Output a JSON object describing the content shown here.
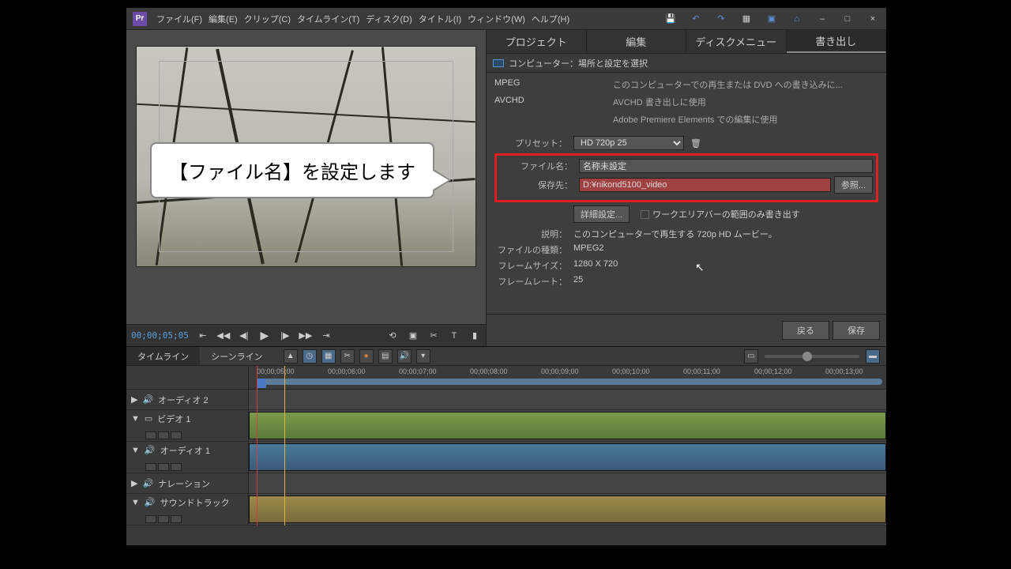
{
  "menubar": {
    "items": [
      "ファイル(F)",
      "編集(E)",
      "クリップ(C)",
      "タイムライン(T)",
      "ディスク(D)",
      "タイトル(I)",
      "ウィンドウ(W)",
      "ヘルプ(H)"
    ]
  },
  "transport": {
    "timecode": "00;00;05;05"
  },
  "tabs": {
    "items": [
      "プロジェクト",
      "編集",
      "ディスクメニュー",
      "書き出し"
    ],
    "active": 3
  },
  "export": {
    "subheader": "コンピューター：場所と設定を選択",
    "formats": [
      {
        "name": "MPEG",
        "desc": "このコンピューターでの再生または DVD への書き込みに..."
      },
      {
        "name": "AVCHD",
        "desc": "AVCHD 書き出しに使用"
      },
      {
        "name": "",
        "desc": "Adobe Premiere Elements での編集に使用"
      }
    ],
    "preset_label": "プリセット：",
    "preset_value": "HD 720p 25",
    "filename_label": "ファイル名：",
    "filename_value": "名称未設定",
    "saveto_label": "保存先：",
    "saveto_value": "D:¥nikond5100_video",
    "browse": "参照...",
    "advanced": "詳細設定...",
    "workarea_only": "ワークエリアバーの範囲のみ書き出す",
    "info_desc_label": "説明：",
    "info_desc_value": "このコンピューターで再生する 720p HD ムービー。",
    "info_type_label": "ファイルの種類：",
    "info_type_value": "MPEG2",
    "info_size_label": "フレームサイズ：",
    "info_size_value": "1280 X 720",
    "info_rate_label": "フレームレート：",
    "info_rate_value": "25",
    "back": "戻る",
    "save": "保存"
  },
  "timeline": {
    "tabs": [
      "タイムライン",
      "シーンライン"
    ],
    "ruler": [
      "00;00;05;00",
      "00;00;06;00",
      "00;00;07;00",
      "00;00;08;00",
      "00;00;09;00",
      "00;00;10;00",
      "00;00;11;00",
      "00;00;12;00",
      "00;00;13;00"
    ],
    "tracks": [
      {
        "name": "オーディオ 2",
        "type": "audio",
        "tall": false
      },
      {
        "name": "ビデオ 1",
        "type": "video",
        "tall": true
      },
      {
        "name": "オーディオ 1",
        "type": "audio",
        "tall": true
      },
      {
        "name": "ナレーション",
        "type": "audio",
        "tall": false
      },
      {
        "name": "サウンドトラック",
        "type": "sound",
        "tall": true
      }
    ]
  },
  "callout": {
    "text": "【ファイル名】を設定します"
  }
}
